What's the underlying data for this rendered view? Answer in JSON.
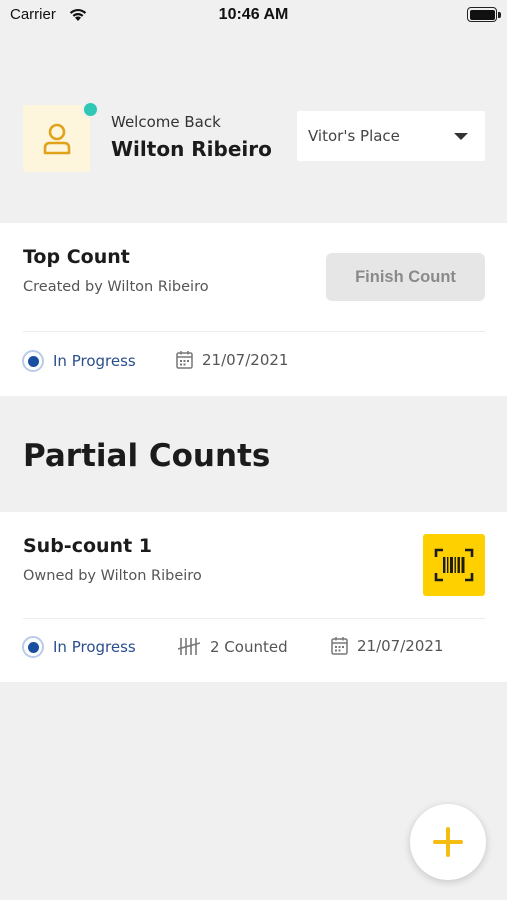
{
  "status_bar": {
    "carrier": "Carrier",
    "time": "10:46 AM"
  },
  "header": {
    "welcome": "Welcome Back",
    "user_name": "Wilton Ribeiro",
    "place": "Vitor's Place"
  },
  "top_count": {
    "title": "Top Count",
    "created_by": "Created by Wilton Ribeiro",
    "finish_label": "Finish Count",
    "status": "In Progress",
    "date": "21/07/2021"
  },
  "partial_counts": {
    "title": "Partial Counts",
    "items": [
      {
        "title": "Sub-count 1",
        "owner": "Owned by Wilton Ribeiro",
        "status": "In Progress",
        "counted": "2 Counted",
        "date": "21/07/2021"
      }
    ]
  },
  "icons": {
    "avatar": "user-icon",
    "calendar": "calendar-icon",
    "tally": "tally-icon",
    "scan": "barcode-scan-icon",
    "add": "plus-icon"
  },
  "colors": {
    "accent": "#ffd000",
    "online": "#2fc7b6",
    "status_blue": "#1a4fa0",
    "avatar_bg": "#fdf5dc"
  }
}
